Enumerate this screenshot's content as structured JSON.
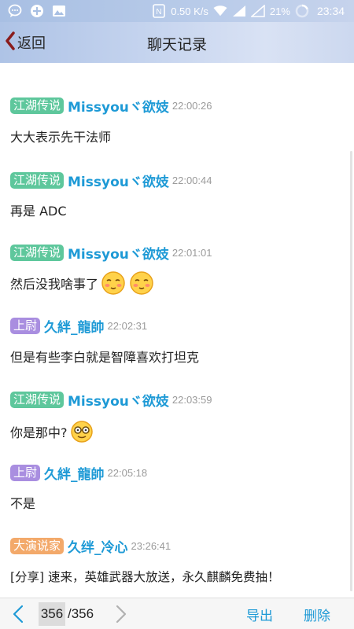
{
  "status_bar": {
    "speed": "0.50 K/s",
    "battery": "21%",
    "time": "23:34"
  },
  "header": {
    "back_label": "返回",
    "title": "聊天记录"
  },
  "colors": {
    "green_badge": "#5ec79c",
    "purple_badge": "#a98ee0",
    "orange_badge": "#f3a96a",
    "name": "#1e9ad6",
    "accent": "#1e9ad6"
  },
  "messages": [
    {
      "badge": "江湖传说",
      "badge_color": "green",
      "name": "Missyouヾ欲妓",
      "time": "22:00:26",
      "text": "大大表示先干法师",
      "emoji": []
    },
    {
      "badge": "江湖传说",
      "badge_color": "green",
      "name": "Missyouヾ欲妓",
      "time": "22:00:44",
      "text": "再是 ADC",
      "emoji": []
    },
    {
      "badge": "江湖传说",
      "badge_color": "green",
      "name": "Missyouヾ欲妓",
      "time": "22:01:01",
      "text": "然后没我啥事了",
      "emoji": [
        "blush-emoji",
        "blush-emoji"
      ]
    },
    {
      "badge": "上尉",
      "badge_color": "purple",
      "name": "久絆_龍帥",
      "time": "22:02:31",
      "text": "但是有些李白就是智障喜欢打坦克",
      "emoji": []
    },
    {
      "badge": "江湖传说",
      "badge_color": "green",
      "name": "Missyouヾ欲妓",
      "time": "22:03:59",
      "text": "你是那中?",
      "emoji": [
        "glasses-emoji"
      ]
    },
    {
      "badge": "上尉",
      "badge_color": "purple",
      "name": "久絆_龍帥",
      "time": "22:05:18",
      "text": "不是",
      "emoji": []
    },
    {
      "badge": "大演说家",
      "badge_color": "orange",
      "name": "久绊_冷心",
      "time": "23:26:41",
      "text": "[分享] 速来，英雄武器大放送，永久麒麟免费抽！",
      "emoji": []
    }
  ],
  "footer": {
    "current_page": "356",
    "total_pages": "/356",
    "export_label": "导出",
    "delete_label": "删除"
  }
}
